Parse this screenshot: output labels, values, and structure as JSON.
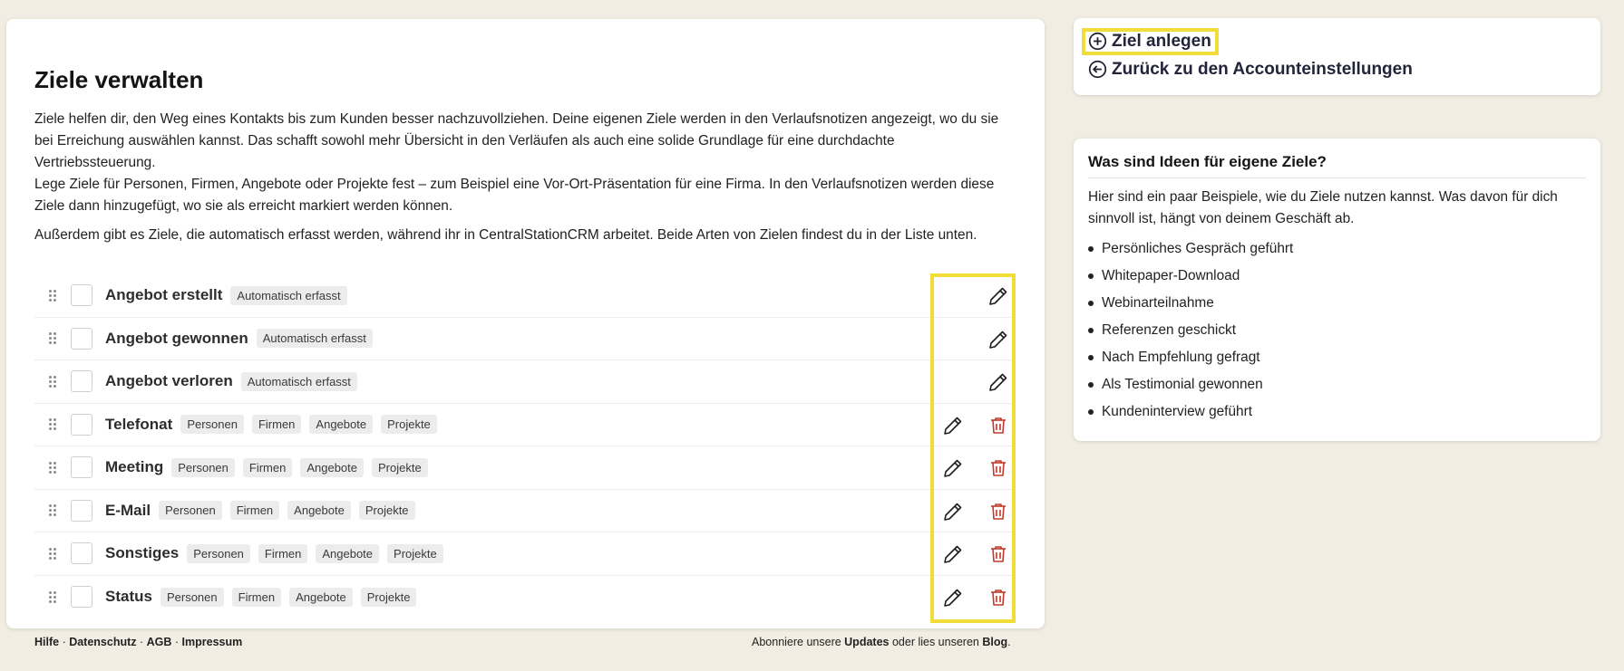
{
  "main": {
    "title": "Ziele verwalten",
    "intro": [
      "Ziele helfen dir, den Weg eines Kontakts bis zum Kunden besser nachzuvollziehen. Deine eigenen Ziele werden in den Verlaufsnotizen angezeigt, wo du sie bei Erreichung auswählen kannst. Das schafft sowohl mehr Übersicht in den Verläufen als auch eine solide Grundlage für eine durchdachte Vertriebssteuerung.",
      "Lege Ziele für Personen, Firmen, Angebote oder Projekte fest – zum Beispiel eine Vor-Ort-Präsentation für eine Firma. In den Verlaufsnotizen werden diese Ziele dann hinzugefügt, wo sie als erreicht markiert werden können.",
      "Außerdem gibt es Ziele, die automatisch erfasst werden, während ihr in CentralStationCRM arbeitet. Beide Arten von Zielen findest du in der Liste unten."
    ],
    "goals": [
      {
        "name": "Angebot erstellt",
        "tags": [
          "Automatisch erfasst"
        ],
        "deletable": false
      },
      {
        "name": "Angebot gewonnen",
        "tags": [
          "Automatisch erfasst"
        ],
        "deletable": false
      },
      {
        "name": "Angebot verloren",
        "tags": [
          "Automatisch erfasst"
        ],
        "deletable": false
      },
      {
        "name": "Telefonat",
        "tags": [
          "Personen",
          "Firmen",
          "Angebote",
          "Projekte"
        ],
        "deletable": true
      },
      {
        "name": "Meeting",
        "tags": [
          "Personen",
          "Firmen",
          "Angebote",
          "Projekte"
        ],
        "deletable": true
      },
      {
        "name": "E-Mail",
        "tags": [
          "Personen",
          "Firmen",
          "Angebote",
          "Projekte"
        ],
        "deletable": true
      },
      {
        "name": "Sonstiges",
        "tags": [
          "Personen",
          "Firmen",
          "Angebote",
          "Projekte"
        ],
        "deletable": true
      },
      {
        "name": "Status",
        "tags": [
          "Personen",
          "Firmen",
          "Angebote",
          "Projekte"
        ],
        "deletable": true
      }
    ]
  },
  "actions": {
    "create_goal": "Ziel anlegen",
    "back_to_account": "Zurück zu den Accounteinstellungen"
  },
  "ideas": {
    "title": "Was sind Ideen für eigene Ziele?",
    "text": "Hier sind ein paar Beispiele, wie du Ziele nutzen kannst. Was davon für dich sinnvoll ist, hängt von deinem Geschäft ab.",
    "items": [
      "Persönliches Gespräch geführt",
      "Whitepaper-Download",
      "Webinarteilnahme",
      "Referenzen geschickt",
      "Nach Empfehlung gefragt",
      "Als Testimonial gewonnen",
      "Kundeninterview geführt"
    ]
  },
  "footer": {
    "left_links": [
      "Hilfe",
      "Datenschutz",
      "AGB",
      "Impressum"
    ],
    "separator": " · ",
    "right_prefix": "Abonniere unsere ",
    "right_link1": "Updates",
    "right_middle": " oder lies unseren ",
    "right_link2": "Blog",
    "right_suffix": "."
  },
  "colors": {
    "highlight": "#f0dd3a",
    "delete": "#c0392b",
    "background": "#f1ede2"
  }
}
